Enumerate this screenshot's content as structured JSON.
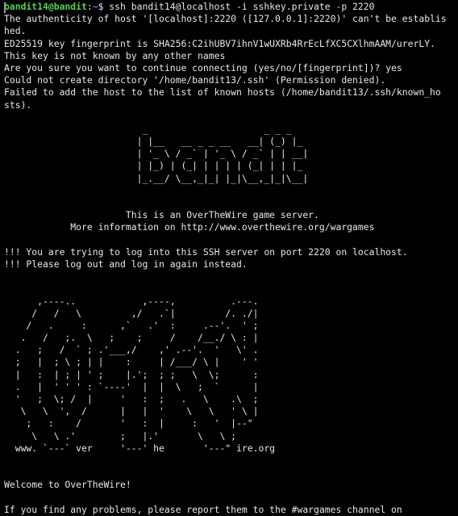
{
  "prompt": {
    "user_host": "bandit14@bandit",
    "separator": ":",
    "path": "~",
    "symbol": "$",
    "command": " ssh bandit14@localhost -i sshkey.private -p 2220"
  },
  "ssh_output": [
    "The authenticity of host '[localhost]:2220 ([127.0.0.1]:2220)' can't be establis",
    "hed.",
    "ED25519 key fingerprint is SHA256:C2ihUBV7ihnV1wUXRb4RrEcLfXC5CXlhmAAM/urerLY.",
    "This key is not known by any other names",
    "Are you sure you want to continue connecting (yes/no/[fingerprint])? yes",
    "Could not create directory '/home/bandit13/.ssh' (Permission denied).",
    "Failed to add the host to the list of known hosts (/home/bandit13/.ssh/known_ho",
    "sts)."
  ],
  "bandit_banner": [
    "                         _                     _ _ _",
    "                        | |__   __ _ _ __   __| (_) |_",
    "                        | '_ \\ / _` | '_ \\ / _` | | __|",
    "                        | |_) | (_| | | | | (_| | | |_",
    "                        |_.__/ \\__,_|_| |_|\\__,_|_|\\__|"
  ],
  "server_info": [
    "                      This is an OverTheWire game server.",
    "            More information on http://www.overthewire.org/wargames"
  ],
  "warnings": [
    "!!! You are trying to log into this SSH server on port 2220 on localhost.",
    "!!! Please log out and log in again instead."
  ],
  "otw_logo": [
    "      ,----..            ,----,          .---.",
    "     /   /   \\         ,/   .`|         /. ./|",
    "    /   .     :      ,`   .'  :     .--'.  ' ;",
    "   .   /   ;.  \\   ;    ;     /    /__./ \\ : |",
    "  .   ;   /  ` ; .'___,/    ,' .--'.  '   \\' .",
    "  ;   |  ; \\ ; | |    :     | /___/ \\ |    ' '",
    "  |   :  | ; | ' ;    |.';  ; ;   \\  \\;      :",
    "  .   |  ' ' ' : `----'  |  |  \\   ;  `      |",
    "  '   ;  \\; /  |     '   :  ;   .   \\    .\\  ;",
    "   \\   \\  ',  /      |   |  '    \\   \\   ' \\ |",
    "    ;   :    /       '   :  |     :   '  |--\"",
    "     \\   \\ .'        ;   |.'       \\   \\ ;",
    "  www. `---` ver     '---' he       '---\" ire.org"
  ],
  "welcome": "Welcome to OverTheWire!",
  "report_line": "If you find any problems, please report them to the #wargames channel on"
}
